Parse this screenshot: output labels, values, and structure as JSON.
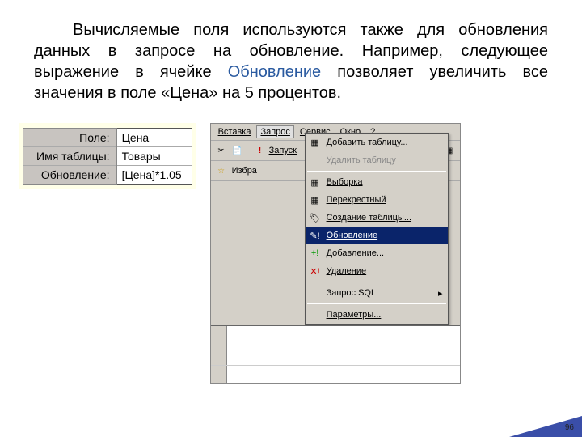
{
  "para": {
    "t1": "Вычисляемые поля используются также для обновления данных в запросе на обновление. Например, следующее выражение в ячейке ",
    "upd": "Обновление",
    "t2": " позволяет увеличить все значения в поле «Цена» на 5 процентов."
  },
  "grid": {
    "labels": {
      "field": "Поле:",
      "table": "Имя таблицы:",
      "update": "Обновление:"
    },
    "values": {
      "field": "Цена",
      "table": "Товары",
      "update": "[Цена]*1.05"
    }
  },
  "menubar": {
    "insert": "Вставка",
    "query": "Запрос",
    "service": "Сервис",
    "window": "Окно",
    "help": "?"
  },
  "toolbar": {
    "cut": "✂",
    "copy": "📄",
    "run_bang": "!",
    "run": "Запуск"
  },
  "fav": {
    "label": "Избра",
    "star": "☆"
  },
  "dropdown": {
    "add_table": "Добавить таблицу...",
    "del_table": "Удалить таблицу",
    "select": "Выборка",
    "crosstab": "Перекрестный",
    "make_table": "Создание таблицы...",
    "update": "Обновление",
    "append": "Добавление...",
    "delete": "Удаление",
    "sql": "Запрос SQL",
    "params": "Параметры..."
  },
  "page": "96"
}
